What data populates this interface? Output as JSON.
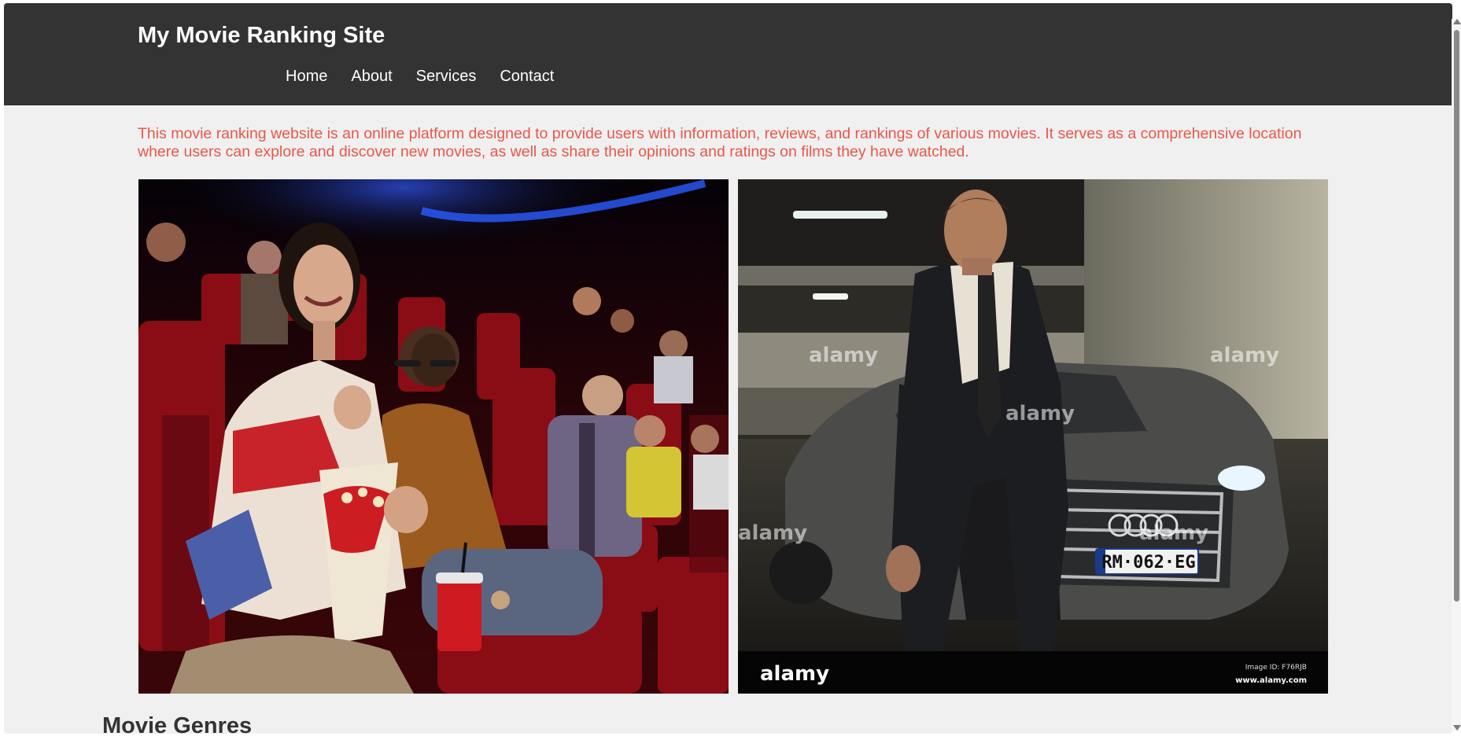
{
  "site": {
    "title": "My Movie Ranking Site"
  },
  "nav": {
    "items": [
      "Home",
      "About",
      "Services",
      "Contact"
    ]
  },
  "intro": {
    "text": "This movie ranking website is an online platform designed to provide users with information, reviews, and rankings of various movies. It serves as a comprehensive location where users can explore and discover new movies, as well as share their opinions and ratings on films they have watched."
  },
  "images": {
    "left": {
      "name": "cinema-audience-image"
    },
    "right": {
      "name": "man-with-car-image",
      "watermark": "alamy",
      "watermark_url": "www.alamy.com",
      "image_id": "Image ID: F76RJB",
      "plate": "RM·062·EG"
    }
  },
  "sections": {
    "genres_title": "Movie Genres"
  },
  "colors": {
    "header_bg": "#333333",
    "page_bg": "#f0f0f0",
    "intro_text": "#e8574a",
    "heading_text": "#333333"
  }
}
